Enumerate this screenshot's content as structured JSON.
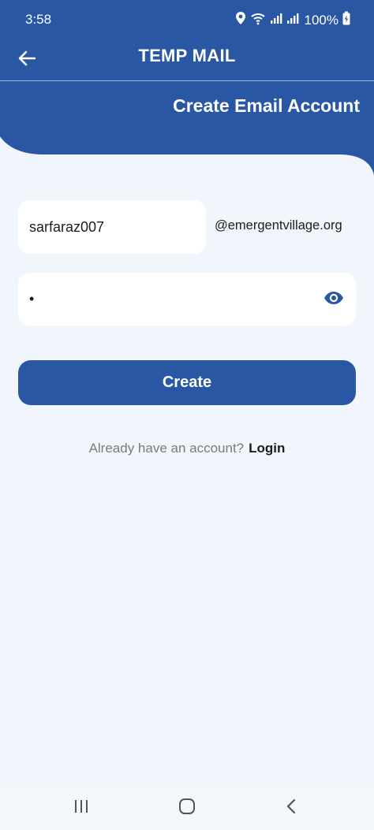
{
  "status_bar": {
    "time": "3:58",
    "battery": "100%",
    "icons": [
      "location-icon",
      "wifi-icon",
      "signal-icon",
      "signal-icon",
      "battery-charging-icon"
    ]
  },
  "appbar": {
    "title": "TEMP MAIL",
    "back_icon": "arrow-left-icon"
  },
  "section_title": "Create Email Account",
  "form": {
    "username_value": "sarfaraz007",
    "domain": "@emergentvillage.org",
    "password_value": "•",
    "password_toggle_icon": "eye-icon",
    "create_label": "Create"
  },
  "login": {
    "prompt": "Already have an account?",
    "link": "Login"
  },
  "nav": {
    "icons": [
      "recent-apps-icon",
      "home-icon",
      "back-icon"
    ]
  },
  "colors": {
    "primary": "#2a57a4",
    "background": "#f1f6fc",
    "text": "#1d1d1d",
    "muted": "#7b7b7b"
  }
}
